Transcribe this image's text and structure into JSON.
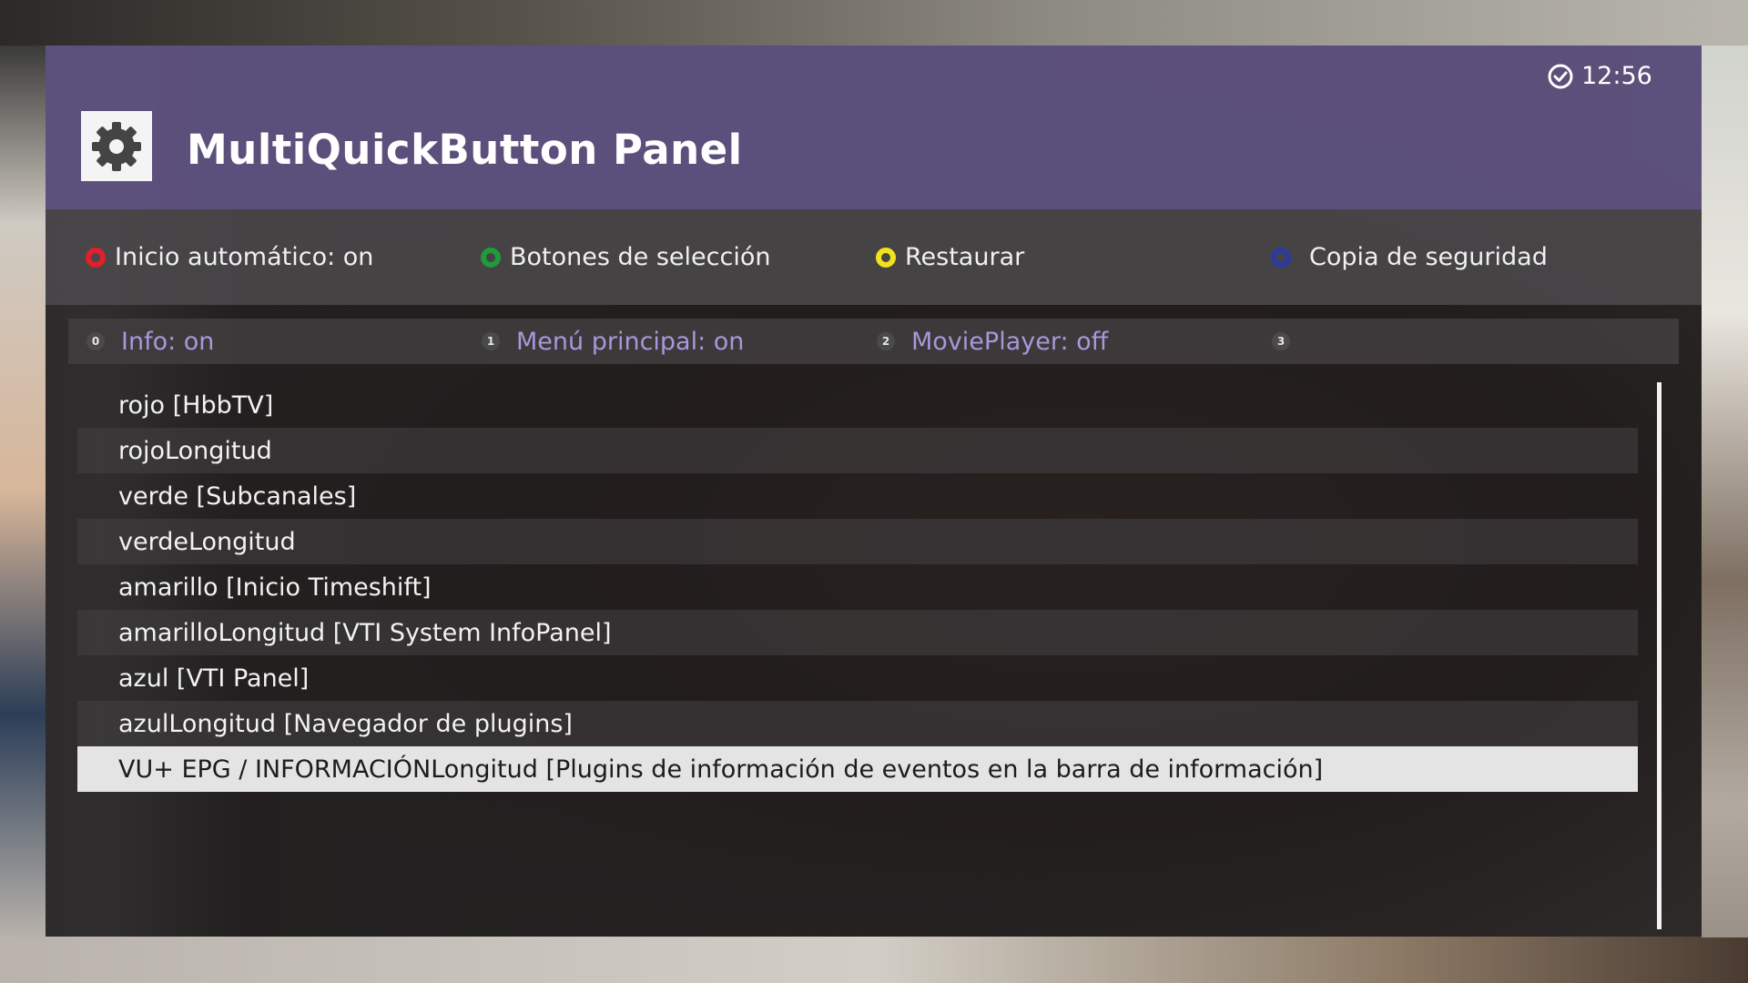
{
  "header": {
    "title": "MultiQuickButton Panel",
    "clock": "12:56",
    "icon": "gear-icon",
    "clock_icon": "clock-check-icon"
  },
  "color_buttons": [
    {
      "label": "Inicio automático: on",
      "color": "#e0202a"
    },
    {
      "label": "Botones de selección",
      "color": "#1f9a3c"
    },
    {
      "label": "Restaurar",
      "color": "#f2e21a"
    },
    {
      "label": "Copia de seguridad",
      "color": "#2c3aa0"
    }
  ],
  "number_buttons": [
    {
      "key": "0",
      "label": "Info: on"
    },
    {
      "key": "1",
      "label": "Menú principal: on"
    },
    {
      "key": "2",
      "label": "MoviePlayer: off"
    },
    {
      "key": "3",
      "label": ""
    }
  ],
  "list": {
    "items": [
      "rojo [HbbTV]",
      "rojoLongitud",
      "verde [Subcanales]",
      "verdeLongitud",
      "amarillo [Inicio Timeshift]",
      "amarilloLongitud [VTI System InfoPanel]",
      "azul [VTI Panel]",
      "azulLongitud [Navegador de plugins]",
      "VU+ EPG / INFORMACIÓNLongitud [Plugins de información de eventos en la barra de información]"
    ],
    "selected_index": 8
  }
}
